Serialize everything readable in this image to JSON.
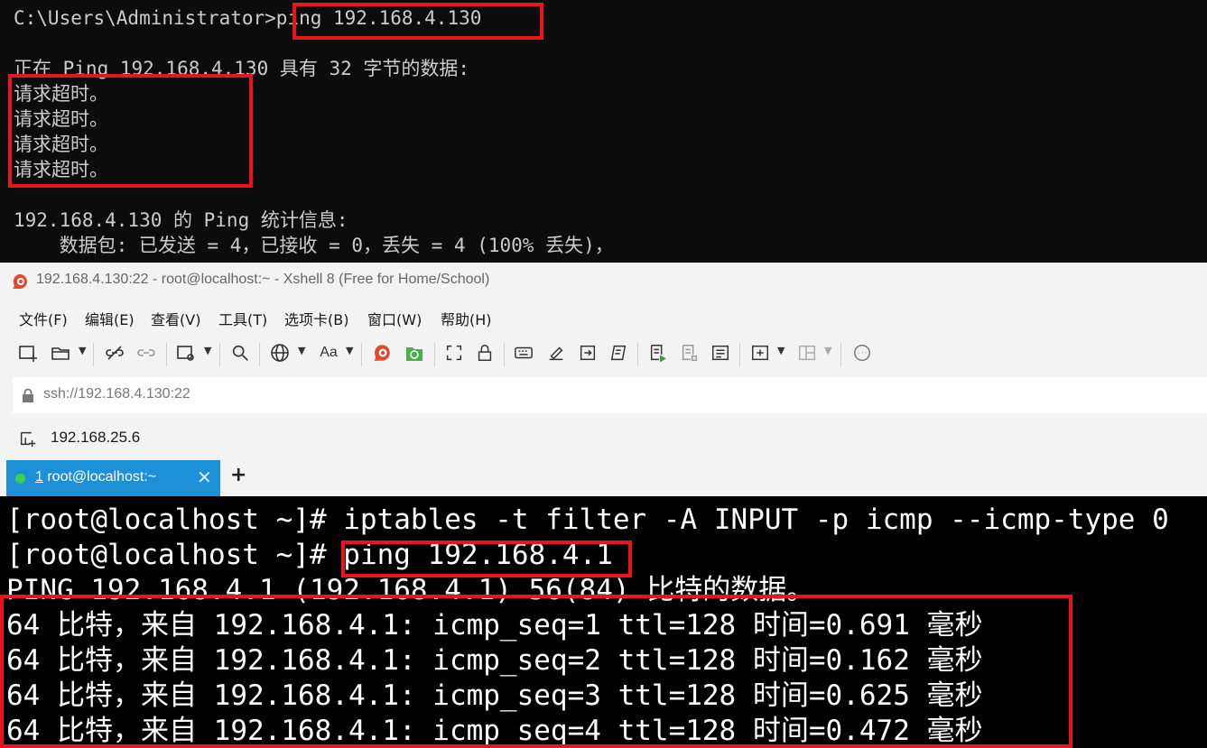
{
  "cmd": {
    "prompt": "C:\\Users\\Administrator>",
    "command": "ping 192.168.4.130",
    "header": "正在 Ping 192.168.4.130 具有 32 字节的数据:",
    "timeouts": [
      "请求超时。",
      "请求超时。",
      "请求超时。",
      "请求超时。"
    ],
    "stats_title": "192.168.4.130 的 Ping 统计信息:",
    "stats_line": "    数据包: 已发送 = 4，已接收 = 0，丢失 = 4 (100% 丢失)，"
  },
  "window": {
    "title": "192.168.4.130:22 - root@localhost:~ - Xshell 8 (Free for Home/School)"
  },
  "menu": [
    "文件(F)",
    "编辑(E)",
    "查看(V)",
    "工具(T)",
    "选项卡(B)",
    "窗口(W)",
    "帮助(H)"
  ],
  "toolbar": {
    "font_label": "Aa",
    "icons": [
      "new-session-icon",
      "open-folder-icon",
      "disconnect-icon",
      "reconnect-icon",
      "new-window-icon",
      "find-icon",
      "globe-icon",
      "font-icon",
      "xshell-icon",
      "xftp-icon",
      "fullscreen-icon",
      "lock-icon",
      "keyboard-icon",
      "compose-icon",
      "transfer-icon",
      "script-icon",
      "start-log-icon",
      "log-icon",
      "notes-icon",
      "add-tab-icon",
      "layout-icon",
      "chat-icon"
    ]
  },
  "address": {
    "url": "ssh://192.168.4.130:22"
  },
  "session": {
    "host": "192.168.25.6"
  },
  "tab": {
    "number": "1",
    "label": " root@localhost:~",
    "close": "✕",
    "add": "+"
  },
  "terminal": {
    "line1": "[root@localhost ~]# iptables -t filter -A INPUT -p icmp --icmp-type 0",
    "prompt2": "[root@localhost ~]# ",
    "command2": "ping 192.168.4.1",
    "ping_header": "PING 192.168.4.1 (192.168.4.1) 56(84) 比特的数据。",
    "replies": [
      "64 比特，来自 192.168.4.1: icmp_seq=1 ttl=128 时间=0.691 毫秒",
      "64 比特，来自 192.168.4.1: icmp_seq=2 ttl=128 时间=0.162 毫秒",
      "64 比特，来自 192.168.4.1: icmp_seq=3 ttl=128 时间=0.625 毫秒",
      "64 比特，来自 192.168.4.1: icmp_seq=4 ttl=128 时间=0.472 毫秒"
    ]
  },
  "colors": {
    "highlight": "#e8161c",
    "tab_active": "#1e90d8",
    "status_dot": "#3bd14a",
    "cmd_bg": "#0c0c0c",
    "terminal_bg": "#000000"
  }
}
